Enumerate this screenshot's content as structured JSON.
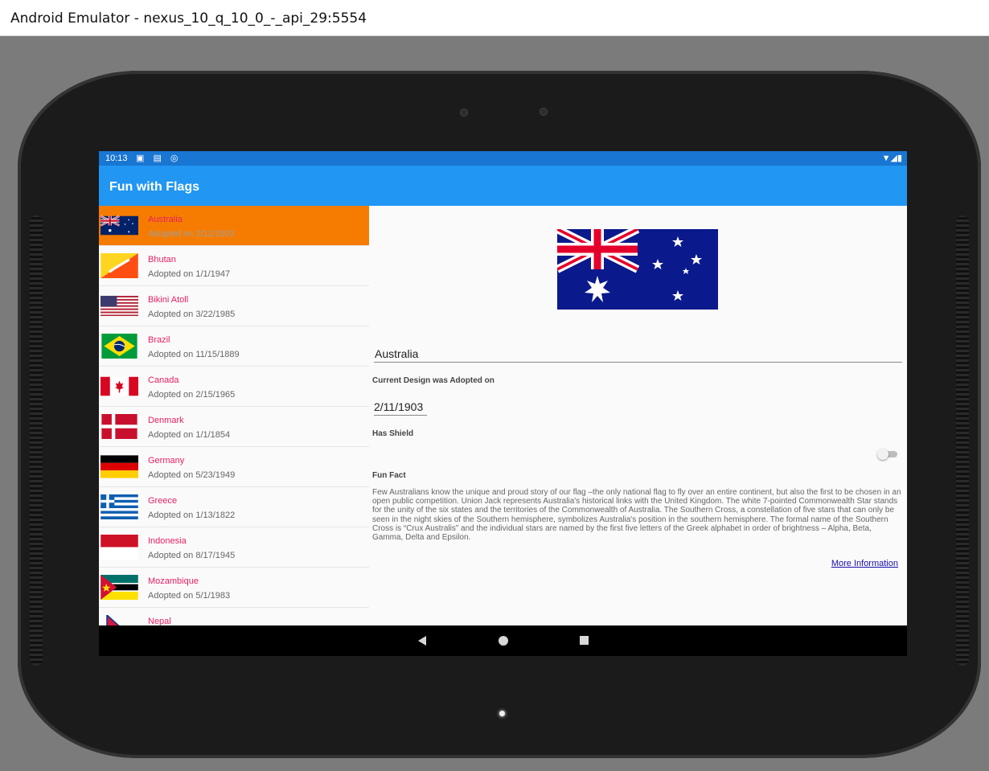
{
  "window": {
    "title": "Android Emulator - nexus_10_q_10_0_-_api_29:5554"
  },
  "status_bar": {
    "time": "10:13",
    "left_icons": "▣ ▤ ◎",
    "right_icons": "▼◢▮"
  },
  "app_bar": {
    "title": "Fun with Flags"
  },
  "flags": [
    {
      "name": "Australia",
      "adopted": "Adopted on 2/11/1903"
    },
    {
      "name": "Bhutan",
      "adopted": "Adopted on 1/1/1947"
    },
    {
      "name": "Bikini Atoll",
      "adopted": "Adopted on 3/22/1985"
    },
    {
      "name": "Brazil",
      "adopted": "Adopted on 11/15/1889"
    },
    {
      "name": "Canada",
      "adopted": "Adopted on 2/15/1965"
    },
    {
      "name": "Denmark",
      "adopted": "Adopted on 1/1/1854"
    },
    {
      "name": "Germany",
      "adopted": "Adopted on 5/23/1949"
    },
    {
      "name": "Greece",
      "adopted": "Adopted on 1/13/1822"
    },
    {
      "name": "Indonesia",
      "adopted": "Adopted on 8/17/1945"
    },
    {
      "name": "Mozambique",
      "adopted": "Adopted on 5/1/1983"
    },
    {
      "name": "Nepal",
      "adopted": ""
    }
  ],
  "detail": {
    "name_value": "Australia",
    "adopted_label": "Current Design was Adopted on",
    "adopted_value": "2/11/1903",
    "shield_label": "Has Shield",
    "shield_on": false,
    "fun_fact_label": "Fun Fact",
    "fun_fact": "Few Australians know the unique and proud story of our flag –the only national flag to fly over an entire continent, but also the first to be chosen in an open public competition. Union Jack represents Australia's historical links with the United Kingdom. The white 7-pointed Commonwealth Star stands for the unity of the six states and the territories of the Commonwealth of Australia. The Southern Cross, a constellation of five stars that can only be seen in the night skies of the Southern hemisphere, symbolizes Australia's position in the southern hemisphere. The formal name of the Southern Cross is “Crux Australis” and the individual stars are named by the first five letters of the Greek alphabet in order of brightness – Alpha, Beta, Gamma, Delta and Epsilon.",
    "more_info": "More Information"
  },
  "colors": {
    "app_bar": "#2196f3",
    "status_bar": "#1976d2",
    "selected_row": "#f57c00",
    "flag_name": "#e91e63"
  }
}
